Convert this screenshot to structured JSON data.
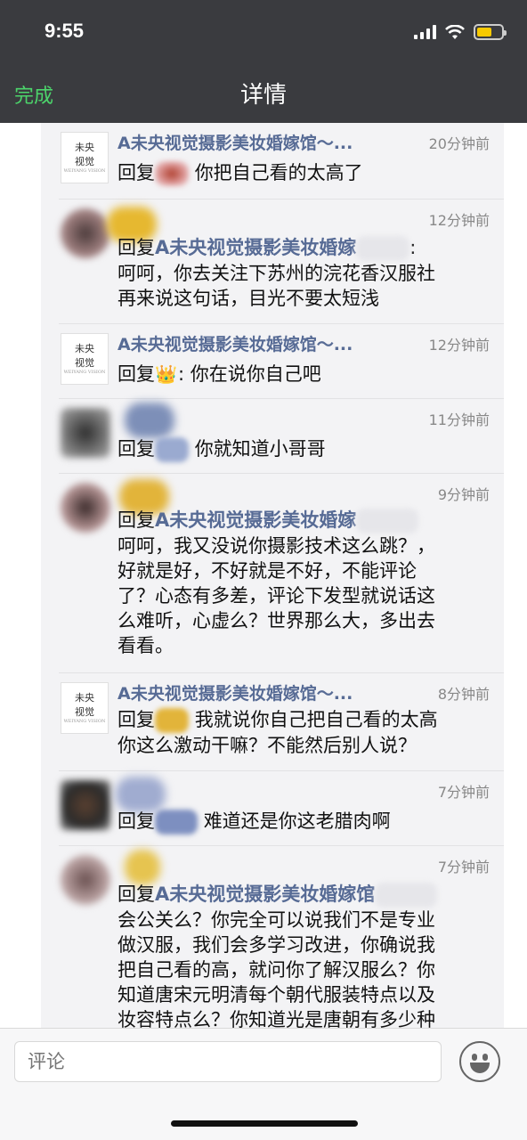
{
  "status": {
    "time": "9:55"
  },
  "nav": {
    "done_label": "完成",
    "title": "详情"
  },
  "logo": {
    "line1": "未央",
    "line2": "视觉",
    "small": "WEIYANG VISION"
  },
  "comments": [
    {
      "name": "A未央视觉摄影美妆婚嫁馆～...",
      "time": "20分钟前",
      "prefix": "回复",
      "text": "你把自己看的太高了"
    },
    {
      "time": "12分钟前",
      "prefix": "回复",
      "link": "A未央视觉摄影美妆婚嫁",
      "after": ":",
      "lines": [
        "呵呵，你去关注下苏州的浣花香汉服社",
        "再来说这句话，目光不要太短浅"
      ]
    },
    {
      "name": "A未央视觉摄影美妆婚嫁馆～...",
      "time": "12分钟前",
      "prefix": "回复",
      "crown": "👑",
      "text": ": 你在说你自己吧"
    },
    {
      "time": "11分钟前",
      "prefix": "回复",
      "text": "你就知道小哥哥"
    },
    {
      "time": "9分钟前",
      "prefix": "回复",
      "link": "A未央视觉摄影美妆婚嫁",
      "lines": [
        "呵呵，我又没说你摄影技术这么跳？，",
        "好就是好，不好就是不好，不能评论",
        "了？心态有多差，评论下发型就说话这",
        "么难听，心虚么？世界那么大，多出去",
        "看看。"
      ]
    },
    {
      "name": "A未央视觉摄影美妆婚嫁馆～...",
      "time": "8分钟前",
      "prefix": "回复",
      "lines": [
        "我就说你自己把自己看的太高",
        "你这么激动干嘛？不能然后别人说？"
      ]
    },
    {
      "time": "7分钟前",
      "prefix": "回复",
      "text": "难道还是你这老腊肉啊"
    },
    {
      "time": "7分钟前",
      "prefix": "回复",
      "link": "A未央视觉摄影美妆婚嫁馆",
      "lines": [
        "会公关么？你完全可以说我们不是专业",
        "做汉服，我们会多学习改进，你确说我",
        "把自己看的高，就问你了解汉服么？你",
        "知道唐宋元明清每个朝代服装特点以及",
        "妆容特点么？你知道光是唐朝有多少种"
      ]
    }
  ],
  "input": {
    "placeholder": "评论"
  }
}
